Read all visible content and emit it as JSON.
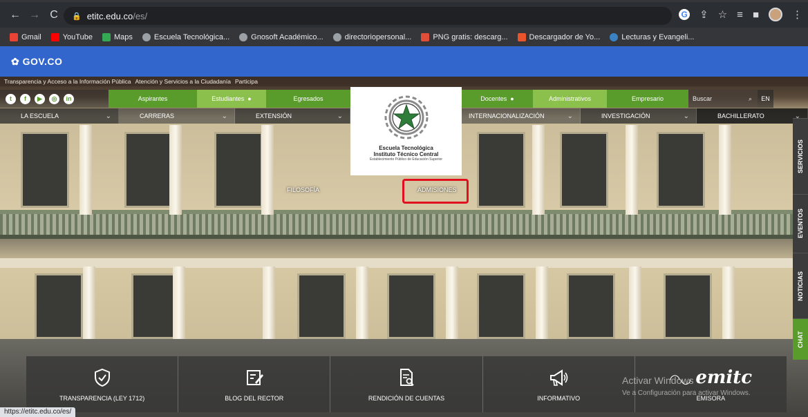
{
  "browser": {
    "url_host": "etitc.edu.co",
    "url_path": "/es/",
    "status_url": "https://etitc.edu.co/es/",
    "bookmarks": [
      {
        "label": "Gmail",
        "color": "#ea4335"
      },
      {
        "label": "YouTube",
        "color": "#ff0000"
      },
      {
        "label": "Maps",
        "color": "#34a853"
      },
      {
        "label": "Escuela Tecnológica...",
        "color": "#9aa0a6"
      },
      {
        "label": "Gnosoft Académico...",
        "color": "#9aa0a6"
      },
      {
        "label": "directoriopersonal...",
        "color": "#9aa0a6"
      },
      {
        "label": "PNG gratis: descarg...",
        "color": "#e04e39"
      },
      {
        "label": "Descargador de Yo...",
        "color": "#e8542b"
      },
      {
        "label": "Lecturas y Evangeli...",
        "color": "#3b82c4"
      }
    ]
  },
  "gov": {
    "label": "GOV.CO"
  },
  "site": {
    "transparency_links": [
      "Transparencia y Acceso a la Información Pública",
      "Atención y Servicios a la Ciudadanía",
      "Participa"
    ],
    "social": [
      "t",
      "f",
      "▶",
      "◎",
      "in"
    ],
    "audience_tabs": [
      "Aspirantes",
      "Estudiantes",
      "Egresados",
      "Docentes",
      "Administrativos",
      "Empresario"
    ],
    "search_placeholder": "Buscar",
    "language": "EN",
    "menu": [
      "LA ESCUELA",
      "CARRERAS",
      "EXTENSIÓN",
      "INTERNACIONALIZACIÓN",
      "INVESTIGACIÓN",
      "BACHILLERATO"
    ],
    "logo": {
      "line1": "Escuela Tecnológica",
      "line2": "Instituto Técnico Central",
      "line3": "Establecimiento Público de Educación Superior"
    },
    "submenu": [
      "FILOSOFÍA",
      "ADMISIONES"
    ],
    "side_tabs": [
      "SERVICIOS",
      "EVENTOS",
      "NOTICIAS",
      "CHAT"
    ],
    "bottom_items": [
      {
        "label": "TRANSPARENCIA (LEY 1712)",
        "icon": "shield-check-icon"
      },
      {
        "label": "BLOG DEL RECTOR",
        "icon": "edit-note-icon"
      },
      {
        "label": "RENDICIÓN DE CUENTAS",
        "icon": "document-search-icon"
      },
      {
        "label": "INFORMATIVO",
        "icon": "megaphone-icon"
      },
      {
        "label": "EMISORA",
        "icon": "emitc-logo",
        "logo_text": "emitc"
      }
    ],
    "watermark_line1": "Activar Windows",
    "watermark_line2": "Ve a Configuración para activar Windows."
  },
  "colors": {
    "green_dark": "#5a9c2c",
    "green_light": "#8cc04d",
    "gov_blue": "#3366cc",
    "highlight_red": "#e0101e"
  }
}
